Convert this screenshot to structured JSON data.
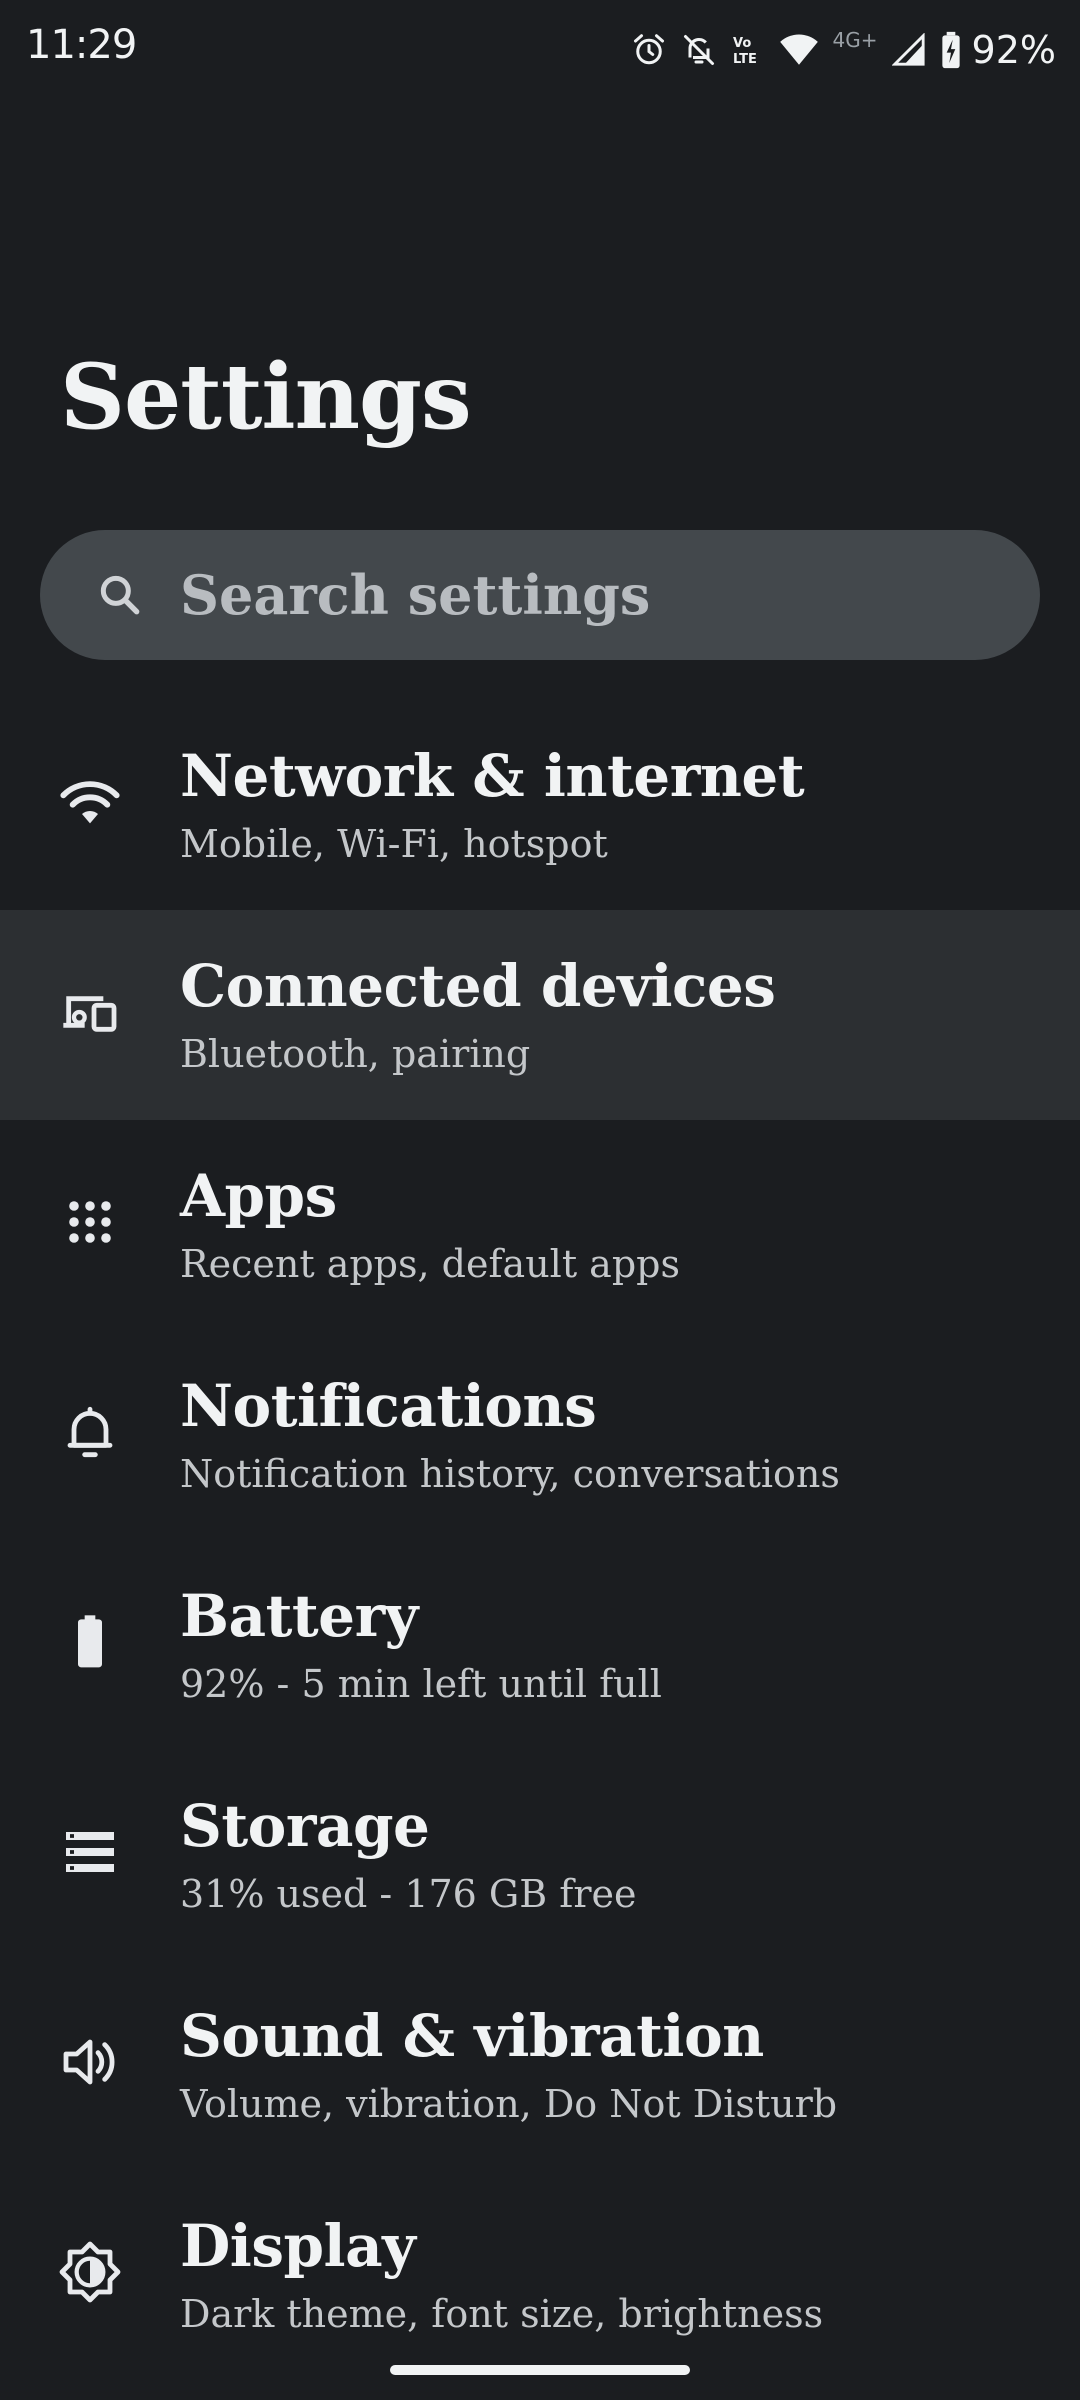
{
  "status_bar": {
    "time": "11:29",
    "network_label": "4G+",
    "battery_percent": "92%",
    "icons": [
      "alarm-icon",
      "bell-off-icon",
      "volte-icon",
      "wifi-icon",
      "cell-signal-icon",
      "battery-charging-icon"
    ]
  },
  "page": {
    "title": "Settings"
  },
  "search": {
    "placeholder": "Search settings"
  },
  "items": [
    {
      "title": "Network & internet",
      "subtitle": "Mobile, Wi-Fi, hotspot",
      "icon": "wifi-icon"
    },
    {
      "title": "Connected devices",
      "subtitle": "Bluetooth, pairing",
      "icon": "devices-icon"
    },
    {
      "title": "Apps",
      "subtitle": "Recent apps, default apps",
      "icon": "apps-grid-icon"
    },
    {
      "title": "Notifications",
      "subtitle": "Notification history, conversations",
      "icon": "bell-icon"
    },
    {
      "title": "Battery",
      "subtitle": "92% - 5 min left until full",
      "icon": "battery-icon"
    },
    {
      "title": "Storage",
      "subtitle": "31% used - 176 GB free",
      "icon": "storage-icon"
    },
    {
      "title": "Sound & vibration",
      "subtitle": "Volume, vibration, Do Not Disturb",
      "icon": "speaker-icon"
    },
    {
      "title": "Display",
      "subtitle": "Dark theme, font size, brightness",
      "icon": "brightness-icon"
    }
  ],
  "colors": {
    "background": "#1b1d20",
    "search_bg": "#43484c",
    "highlight_row": "#2c2f32",
    "text_primary": "#f1f3f4",
    "text_secondary": "#c4c7ca"
  }
}
